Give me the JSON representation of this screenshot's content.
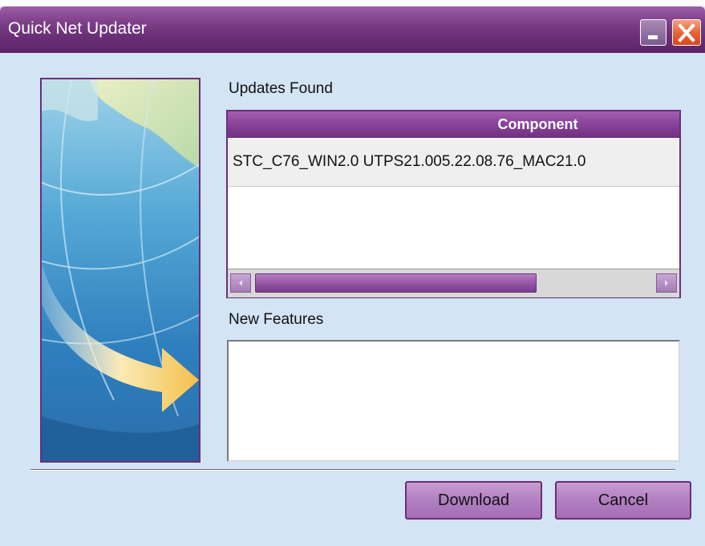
{
  "window": {
    "title": "Quick Net Updater"
  },
  "updates": {
    "label": "Updates Found",
    "column_header": "Component",
    "rows": [
      {
        "component": "STC_C76_WIN2.0 UTPS21.005.22.08.76_MAC21.0"
      }
    ]
  },
  "features": {
    "label": "New Features",
    "value": ""
  },
  "buttons": {
    "download": "Download",
    "cancel": "Cancel"
  },
  "icons": {
    "minimize": "minimize-icon",
    "close": "close-icon",
    "scroll_left": "scroll-left-arrow-icon",
    "scroll_right": "scroll-right-arrow-icon"
  },
  "colors": {
    "titlebar": "#7c3f88",
    "body": "#d3e4f4",
    "close_button": "#e66033"
  }
}
